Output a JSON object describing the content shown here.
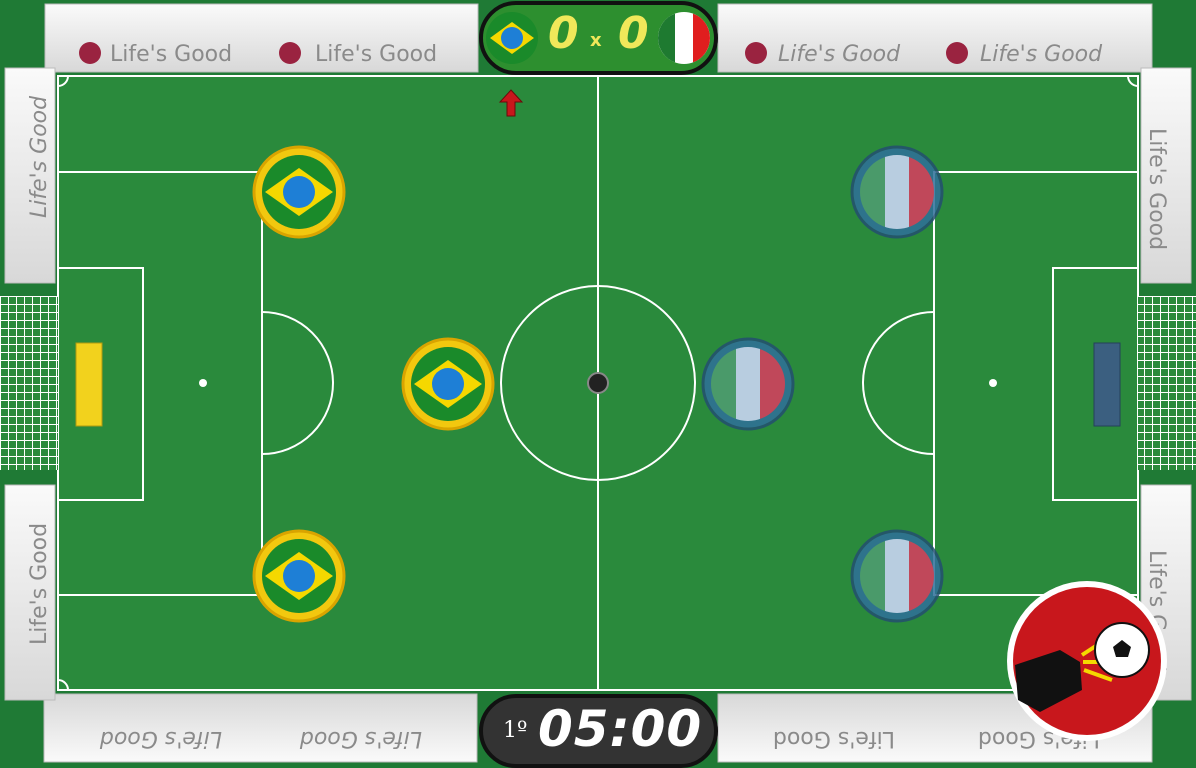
{
  "ad_boards": {
    "text": "Life's Good",
    "brand": "LG"
  },
  "scoreboard": {
    "home_team": "Brazil",
    "away_team": "Italy",
    "home_score": "0",
    "separator": "x",
    "away_score": "0"
  },
  "timer": {
    "period": "1º",
    "time": "05:00"
  },
  "colors": {
    "pitch": "#2a8a3c",
    "home_goal_bar": "#f2d21d",
    "away_goal_bar": "#3b5f80",
    "kick_button": "#c8171c"
  },
  "players": {
    "home": [
      {
        "team": "Brazil",
        "icon": "brazil-flag-icon"
      },
      {
        "team": "Brazil",
        "icon": "brazil-flag-icon"
      },
      {
        "team": "Brazil",
        "icon": "brazil-flag-icon"
      }
    ],
    "away": [
      {
        "team": "Italy",
        "icon": "italy-flag-icon"
      },
      {
        "team": "Italy",
        "icon": "italy-flag-icon"
      },
      {
        "team": "Italy",
        "icon": "italy-flag-icon"
      }
    ]
  },
  "kick_button": {
    "icon": "kick-ball-icon"
  },
  "turn_indicator": {
    "icon": "arrow-up-icon"
  }
}
